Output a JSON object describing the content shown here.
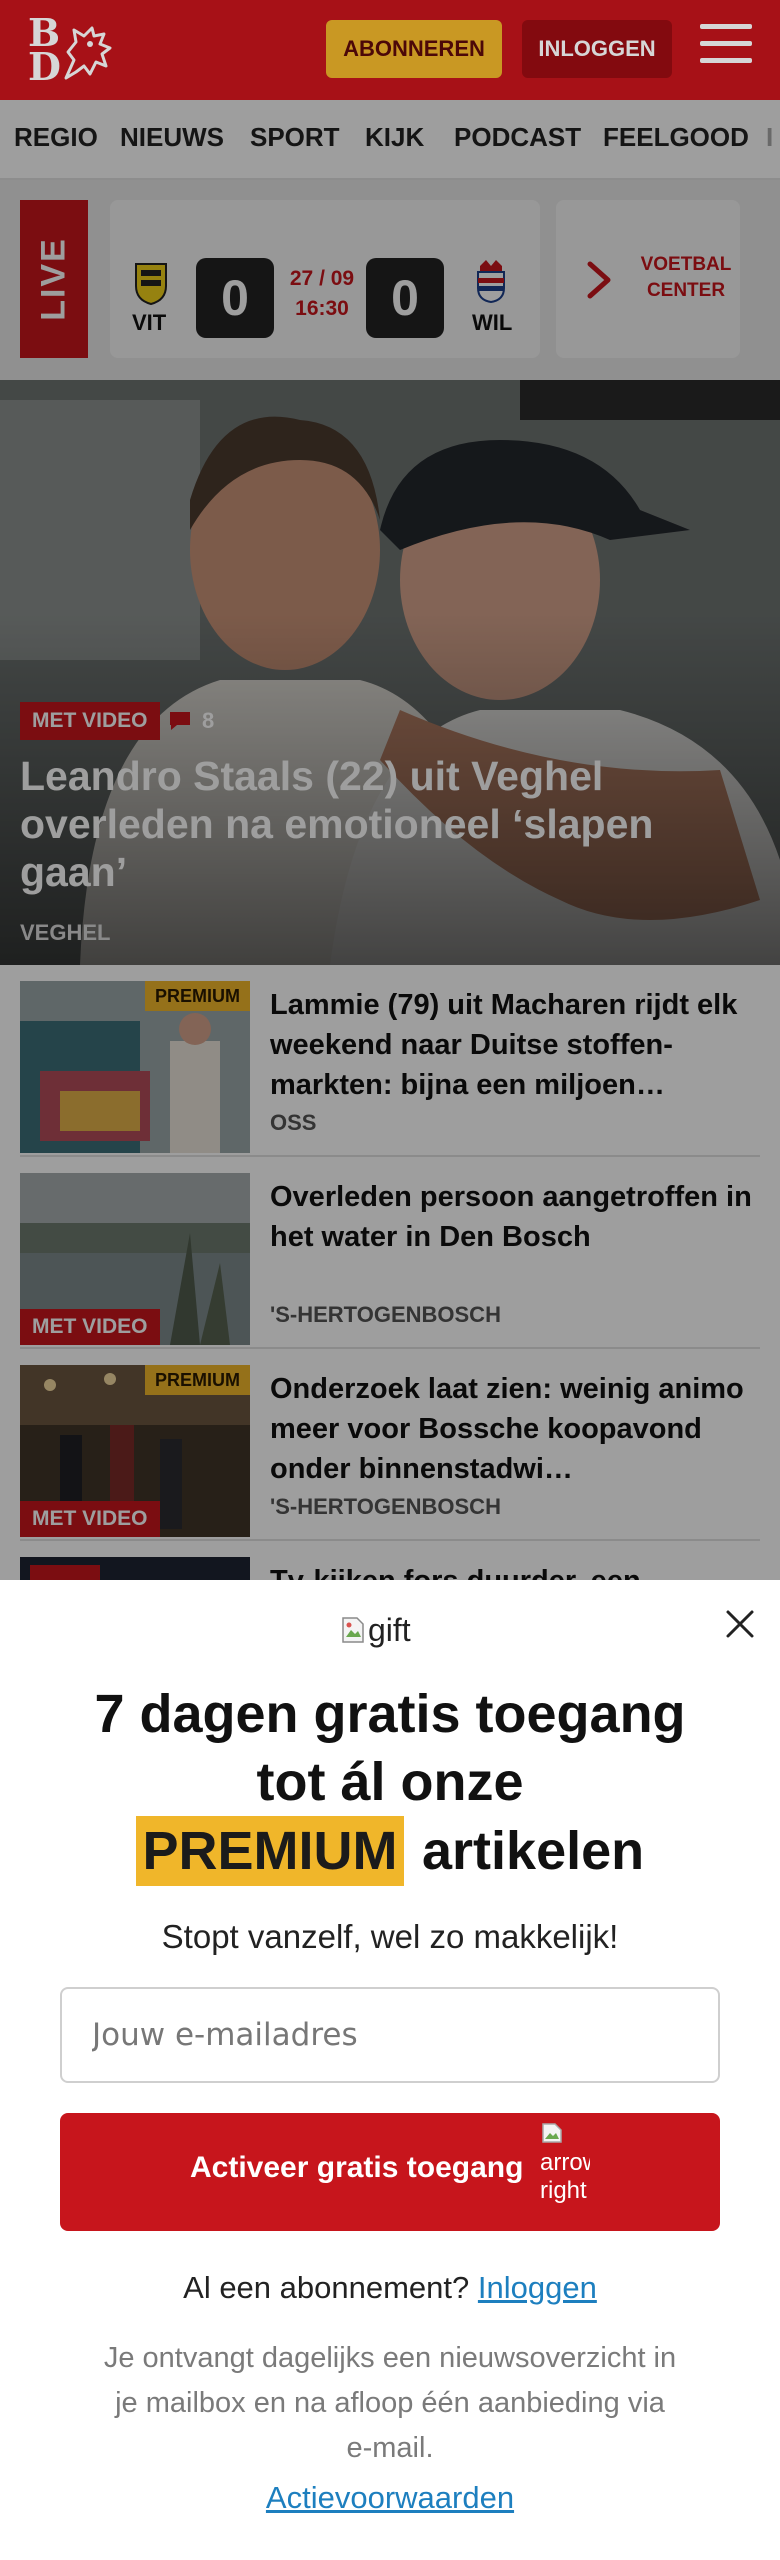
{
  "header": {
    "logo_b": "B",
    "logo_d": "D",
    "subscribe_label": "ABONNEREN",
    "login_label": "INLOGGEN",
    "menu_icon": "hamburger-icon",
    "brand_color": "#c7151c",
    "accent_color": "#f0b62a"
  },
  "nav": {
    "items": [
      "REGIO",
      "NIEUWS",
      "SPORT",
      "KIJK",
      "PODCAST",
      "FEELGOOD",
      "I"
    ]
  },
  "live": {
    "badge": "LIVE",
    "home_team": "VIT",
    "away_team": "WIL",
    "home_score": "0",
    "away_score": "0",
    "date": "27 / 09",
    "time": "16:30",
    "center_label_1": "VOETBAL",
    "center_label_2": "CENTER"
  },
  "hero": {
    "badge": "MET VIDEO",
    "comments": "8",
    "title": "Leandro Staals (22) uit Veghel overleden na emotioneel ‘slapen gaan’",
    "location": "VEGHEL"
  },
  "articles": [
    {
      "title": "Lammie (79) uit Macharen rijdt elk weekend naar Duitse stoffen­markten: bijna een miljoen…",
      "location": "OSS",
      "premium": "PREMIUM",
      "video": ""
    },
    {
      "title": "Overleden persoon aangetroffen in het water in Den Bosch",
      "location": "'S-HERTOGENBOSCH",
      "premium": "",
      "video": "MET VIDEO"
    },
    {
      "title": "Onderzoek laat zien: weinig animo meer voor Bossche koopavond onder binnenstadwi…",
      "location": "'S-HERTOGENBOSCH",
      "premium": "PREMIUM",
      "video": "MET VIDEO"
    },
    {
      "title": "Tv-kijken fors duurder, een",
      "location": "",
      "premium": "",
      "video": ""
    }
  ],
  "modal": {
    "gift_alt": "gift",
    "headline": "7 dagen gratis toegang tot ál onze",
    "premium_word": "PREMIUM",
    "headline_rest": "artikelen",
    "subline": "Stopt vanzelf, wel zo makkelijk!",
    "email_placeholder": "Jouw e-mailadres",
    "cta_label": "Activeer gratis toegang",
    "cta_icon_alt": "arrow right",
    "have_sub_text": "Al een abonnement?",
    "have_sub_link": "Inloggen",
    "fineprint": "Je ontvangt dagelijks een nieuwsoverzicht in je mailbox en na afloop één aanbieding via e-mail.",
    "terms": "Actievoorwaarden"
  }
}
